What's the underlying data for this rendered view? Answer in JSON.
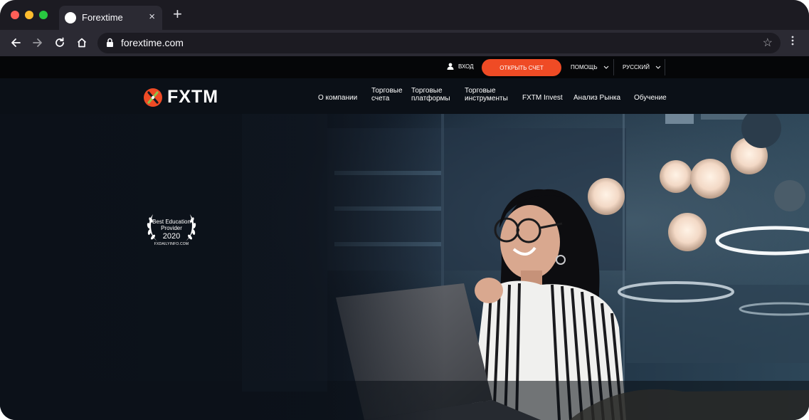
{
  "browser": {
    "tab_title": "Forextime",
    "url": "forextime.com",
    "close_glyph": "×",
    "new_tab_glyph": "+",
    "star_glyph": "☆",
    "menu_glyph": "⋮",
    "traffic_colors": [
      "#ff5f57",
      "#febc2e",
      "#28c840"
    ]
  },
  "topbar": {
    "login": "ВХОД",
    "open_account": "ОТКРЫТЬ СЧЕТ",
    "help": "ПОМОЩЬ",
    "language": "РУССКИЙ"
  },
  "nav": {
    "logo": "FXTM",
    "items": [
      {
        "label": "О компании"
      },
      {
        "label": "Торговые счета"
      },
      {
        "label": "Торговые платформы"
      },
      {
        "label": "Торговые инструменты"
      },
      {
        "label": "FXTM Invest"
      },
      {
        "label": "Анализ Рынка"
      },
      {
        "label": "Обучение"
      }
    ]
  },
  "award": {
    "line1": "Best Education",
    "line2": "Provider",
    "year": "2020",
    "source": "FXDAILYINFO.COM"
  },
  "colors": {
    "accent": "#ef4b25",
    "logo_green": "#8bc34a"
  }
}
